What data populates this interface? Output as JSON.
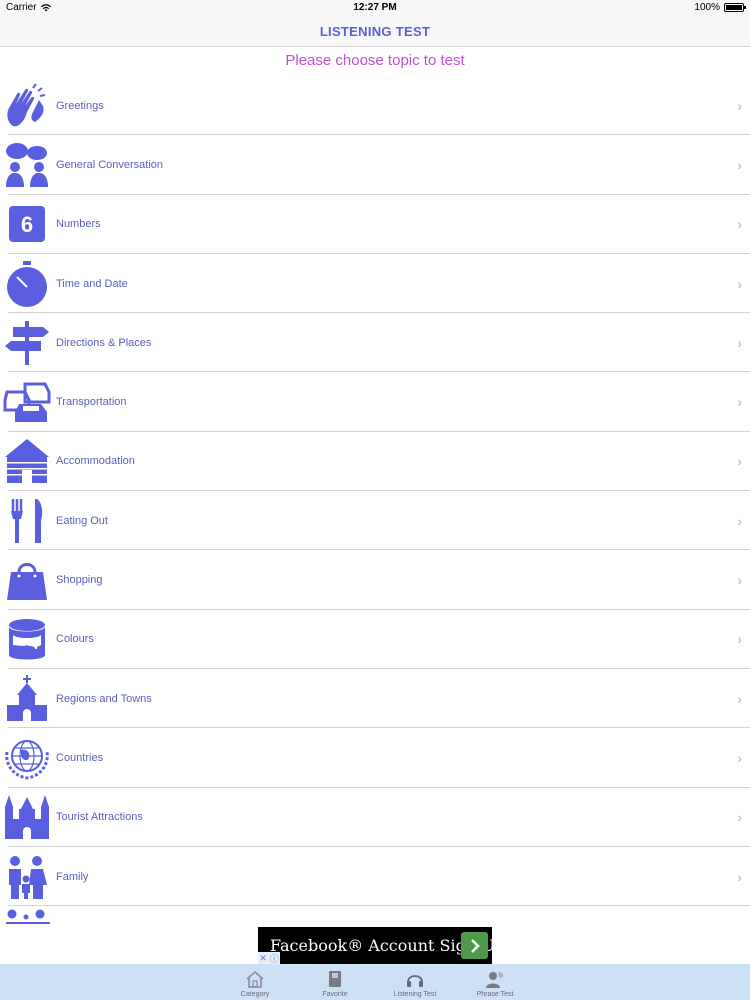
{
  "status_bar": {
    "carrier": "Carrier",
    "time": "12:27 PM",
    "battery": "100%"
  },
  "nav": {
    "title": "LISTENING TEST"
  },
  "subtitle": "Please choose topic to test",
  "colors": {
    "accent": "#5a5fd6",
    "icon": "#5a5fe0",
    "subtitle": "#c24fd3",
    "tab_bar_bg": "#cde1f5",
    "ad_button": "#4f9a4a"
  },
  "topics": [
    {
      "label": "Greetings",
      "icon": "clapping-hands-icon"
    },
    {
      "label": "General Conversation",
      "icon": "people-talking-icon"
    },
    {
      "label": "Numbers",
      "icon": "number-six-icon",
      "glyph": "6"
    },
    {
      "label": "Time and Date",
      "icon": "stopwatch-icon"
    },
    {
      "label": "Directions & Places",
      "icon": "signpost-icon"
    },
    {
      "label": "Transportation",
      "icon": "cars-icon"
    },
    {
      "label": "Accommodation",
      "icon": "cabin-icon"
    },
    {
      "label": "Eating Out",
      "icon": "fork-knife-icon"
    },
    {
      "label": "Shopping",
      "icon": "shopping-bag-icon"
    },
    {
      "label": "Colours",
      "icon": "paint-bucket-icon"
    },
    {
      "label": "Regions and Towns",
      "icon": "church-icon"
    },
    {
      "label": "Countries",
      "icon": "globe-wreath-icon"
    },
    {
      "label": "Tourist Attractions",
      "icon": "castle-icon"
    },
    {
      "label": "Family",
      "icon": "family-icon"
    }
  ],
  "ad": {
    "text": "Facebook® Account Sign U"
  },
  "tabs": [
    {
      "label": "Category",
      "icon": "home-icon"
    },
    {
      "label": "Favorite",
      "icon": "book-icon"
    },
    {
      "label": "Listening Test",
      "icon": "headphones-icon"
    },
    {
      "label": "Phrase Test",
      "icon": "person-speech-icon"
    }
  ]
}
